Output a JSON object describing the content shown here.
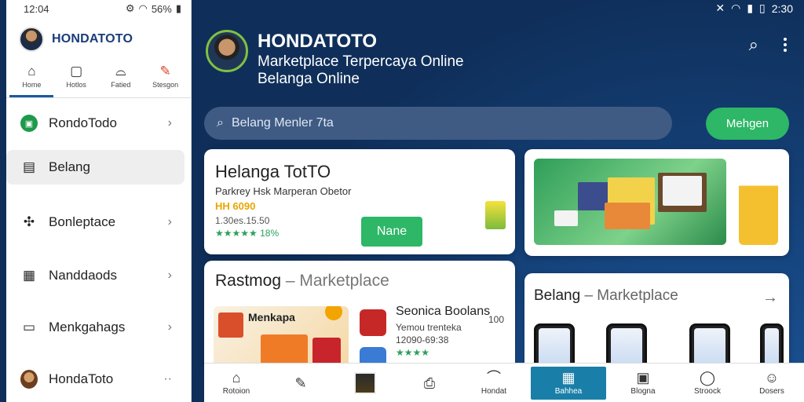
{
  "left_status": {
    "time": "12:04",
    "battery": "56%"
  },
  "right_status": {
    "time": "2:30"
  },
  "drawer": {
    "brand": "HONDATOTO",
    "tabs": [
      {
        "label": "Home",
        "icon": "home-icon",
        "glyph": "⌂"
      },
      {
        "label": "Hotlos",
        "icon": "calendar-icon",
        "glyph": "▢"
      },
      {
        "label": "Fatied",
        "icon": "bag-icon",
        "glyph": "⌓"
      },
      {
        "label": "Stesgon",
        "icon": "color-icon",
        "glyph": "✎"
      }
    ],
    "items": [
      {
        "label": "RondoTodo",
        "icon": "app-badge-icon"
      },
      {
        "label": "Belang",
        "icon": "wallet-icon"
      },
      {
        "label": "Bonleptace",
        "icon": "puzzle-icon"
      },
      {
        "label": "Nanddaods",
        "icon": "calendar-icon"
      },
      {
        "label": "Menkgahags",
        "icon": "box-icon"
      },
      {
        "label": "HondaToto",
        "icon": "profile-icon"
      }
    ]
  },
  "header": {
    "title": "HONDATOTO",
    "subtitle1": "Marketplace Terpercaya Online",
    "subtitle2": "Belanga Online"
  },
  "search": {
    "placeholder": "Belang Menler 7ta",
    "button_label": "Mehgen"
  },
  "card1": {
    "title": "Helanga TotTO",
    "subtitle": "Parkrey Hsk Marperan Obetor",
    "price": "HH 6090",
    "stats": "1.30es.15.50",
    "rating": "★★★★★ 18%",
    "button_label": "Nane"
  },
  "card3": {
    "title_main": "Rastmog",
    "title_muted": "– Marketplace",
    "app_name": "Menkapa",
    "name": "Seonica Boolans",
    "sub": "Yemou trenteka",
    "nums": "12090-69:38",
    "rating": "★★★★",
    "num_right": "100"
  },
  "card4": {
    "title_main": "Belang",
    "title_muted": "– Marketplace",
    "arrow": "→"
  },
  "bottom_nav": [
    {
      "label": "Rotoion",
      "glyph": "⌂"
    },
    {
      "label": "",
      "glyph": "✎"
    },
    {
      "label": "",
      "glyph": "thumb"
    },
    {
      "label": "",
      "glyph": "⎙"
    },
    {
      "label": "Hondat",
      "glyph": "⌒"
    },
    {
      "label": "Bahhea",
      "glyph": "▦"
    },
    {
      "label": "Blogna",
      "glyph": "▣"
    },
    {
      "label": "Stroock",
      "glyph": "◯"
    },
    {
      "label": "Dosers",
      "glyph": "☺"
    }
  ],
  "colors": {
    "primary_green": "#2db767",
    "header_blue": "#0f2f5a",
    "brand_blue": "#1a3c7a",
    "active_nav": "#1a7fa8"
  }
}
